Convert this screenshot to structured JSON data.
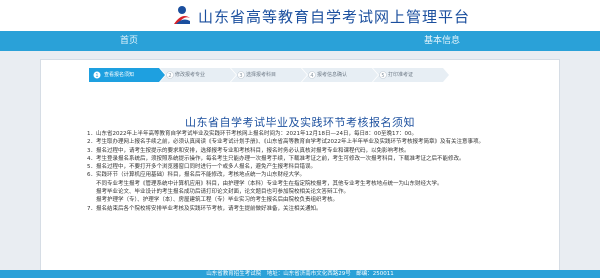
{
  "header": {
    "title": "山东省高等教育自学考试网上管理平台"
  },
  "nav": {
    "home": "首页",
    "info": "基本信息"
  },
  "steps": [
    {
      "num": "1",
      "label": "查看报名须知"
    },
    {
      "num": "2",
      "label": "修改报考专业"
    },
    {
      "num": "3",
      "label": "选择报考科目"
    },
    {
      "num": "4",
      "label": "报考信息确认"
    },
    {
      "num": "5",
      "label": "打印准考证"
    }
  ],
  "notice": {
    "title": "山东省自学考试毕业及实践环节考核报名须知",
    "paragraphs": [
      "1．山东省2022年上半年高等教育自学考试毕业及实践环节考核网上报名时间为：2021年12月18日—24日，每日8：00至晚17：00。",
      "2．考生取办理网上报名手续之前，必须认真阅读《专业考试计划手册》、《山东省高等教育自学考试2022年上半年毕业及实践环节考核报考简章》及有关注意事项。",
      "3．报名过程中，请考生按提示的要求和安排，选择报考专业和考核科目，报名时务必认真核对报考专业和课程代码，以免影响考核。",
      "4．考生登录报名系统后，须按照系统提示操作，每名考生只能办理一次报考手续，下载准考证之前，考生可修改一次报考科目，下载准考证之后不能修改。",
      "5．报名过程中，不要打开多个浏览器窗口同时进行一个或多人报名，避免产生报考科目错误。",
      "6．实践环节（计算机应用基础）科目，报名后不能修改，考核地点统一为山东财经大学。",
      "不同专业考生报考《管理系统中计算机应用》科目，由护理学（本科）专业考生在指定院校报考，其他专业考生考核地点统一为山东财经大学。",
      "报考毕业论文、毕业设计的考生报名成功后请打印论文封面，论文题目也可参加院校相关论文答辩工作。",
      "报考护理学（专）、护理学（本）、房屋建筑工程（专）毕业实习的考生报名后由院校负责组织考核。",
      "7．报名结束后各个院校将安排毕业考核及实践环节考核，请考生提前做好准备，关注相关通知。"
    ]
  },
  "footer": {
    "text": "山东省教育招生考试院　地址：山东省济南市文化西路29号　邮编：250011"
  },
  "colors": {
    "nav": "#2aa1d8",
    "title": "#1b4f9e",
    "step_active": "#1ea0e0",
    "step_inactive": "#e7eef4"
  }
}
